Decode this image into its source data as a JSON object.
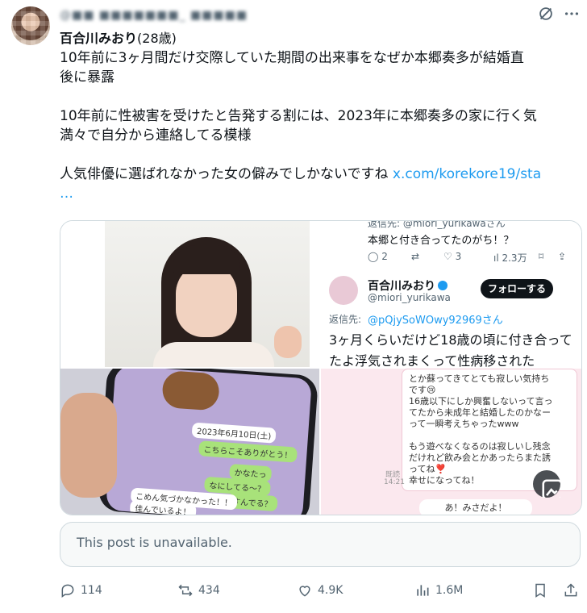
{
  "header": {
    "blurred_handle": "@■■ ■■■■■■■_ ■■■■■",
    "display_name": "百合川みおり",
    "age_suffix": "(28歳)"
  },
  "post": {
    "lines": [
      "10年前に3ヶ月間だけ交際していた期間の出来事をなぜか本郷奏多が結婚直",
      "後に暴露",
      "",
      "10年前に性被害を受けたと告発する割には、2023年に本郷奏多の家に行く気",
      "満々で自分から連絡してる模様",
      "",
      "人気俳優に選ばれなかった女の僻みでしかないですね "
    ],
    "link_text": "x.com/korekore19/sta",
    "ellipsis": "…"
  },
  "media": {
    "reply_to_top": "返信先: @miori_yurikawaさん",
    "reply_text_top": "本郷と付き合ってたのがち！？",
    "stats": {
      "replies": "2",
      "retweets": "",
      "likes": "3",
      "views": "2.3万"
    },
    "quoted_name": "百合川みおり",
    "quoted_handle": "@miori_yurikawa",
    "follow_button": "フォローする",
    "reply_to_label": "返信先:",
    "reply_to_handle": "@pQjySoWOwy92969さん",
    "quoted_text_1": "3ヶ月くらいだけど18歳の頃に付き合って",
    "quoted_text_2": "たよ浮気されまくって性病移された",
    "chat_lines": [
      "こちらこそありがとう！",
      "かなたっ",
      "なにしてる〜？",
      "すんでる？",
      "こめん気づかなかった！！",
      "佳んでいるよ！"
    ],
    "chat_date": "2023年6月10日(土)",
    "line_lines": [
      "とか蘇ってきてとても寂しい気持ち",
      "です😢",
      "16歳以下にしか興奮しないって言っ",
      "てたから未成年と結婚したのかなー",
      "って一瞬考えちゃったwww",
      "",
      "もう遊べなくなるのは寂しいし残念",
      "だけれど飲み会とかあったらまた誘",
      "ってね❣️",
      "幸せになってね！"
    ],
    "line_read": "既読",
    "line_time": "14:21",
    "line_bottom": "あ！みさだよ！"
  },
  "unavailable_text": "This post is unavailable.",
  "actions": {
    "replies": "114",
    "reposts": "434",
    "likes": "4.9K",
    "views": "1.6M"
  }
}
